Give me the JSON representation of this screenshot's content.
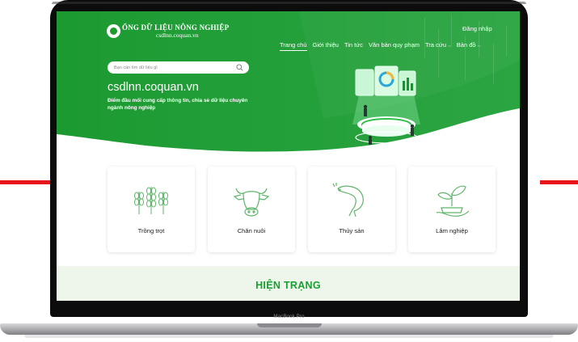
{
  "device": {
    "label": "MacBook Pro"
  },
  "header": {
    "logo_name": "ỔNG DỮ LIỆU NÔNG NGHIỆP",
    "logo_domain": "csdlnn.coquan.vn",
    "login_label": "Đăng nhập",
    "nav": [
      {
        "label": "Trang chủ",
        "active": true
      },
      {
        "label": "Giới thiệu"
      },
      {
        "label": "Tin tức"
      },
      {
        "label": "Văn bản quy phạm"
      },
      {
        "label": "Tra cứu",
        "dropdown": true
      },
      {
        "label": "Bản đồ",
        "dropdown": true
      }
    ]
  },
  "hero": {
    "search_placeholder": "Bạn cần tìm dữ liệu gì",
    "site_title": "csdlnn.coquan.vn",
    "description": "Điểm đầu mối cung cấp thông tin, chia sẻ dữ liệu chuyên ngành nông nghiệp"
  },
  "categories": [
    {
      "label": "Trồng trọt",
      "icon": "wheat-icon"
    },
    {
      "label": "Chăn nuôi",
      "icon": "cow-icon"
    },
    {
      "label": "Thủy sản",
      "icon": "shrimp-icon"
    },
    {
      "label": "Lâm nghiệp",
      "icon": "seedling-hand-icon"
    }
  ],
  "status_section": {
    "title": "HIỆN TRẠNG"
  },
  "colors": {
    "brand_green": "#1e9b2c",
    "hero_green": "#27a13a",
    "accent_red": "#e8141c"
  }
}
